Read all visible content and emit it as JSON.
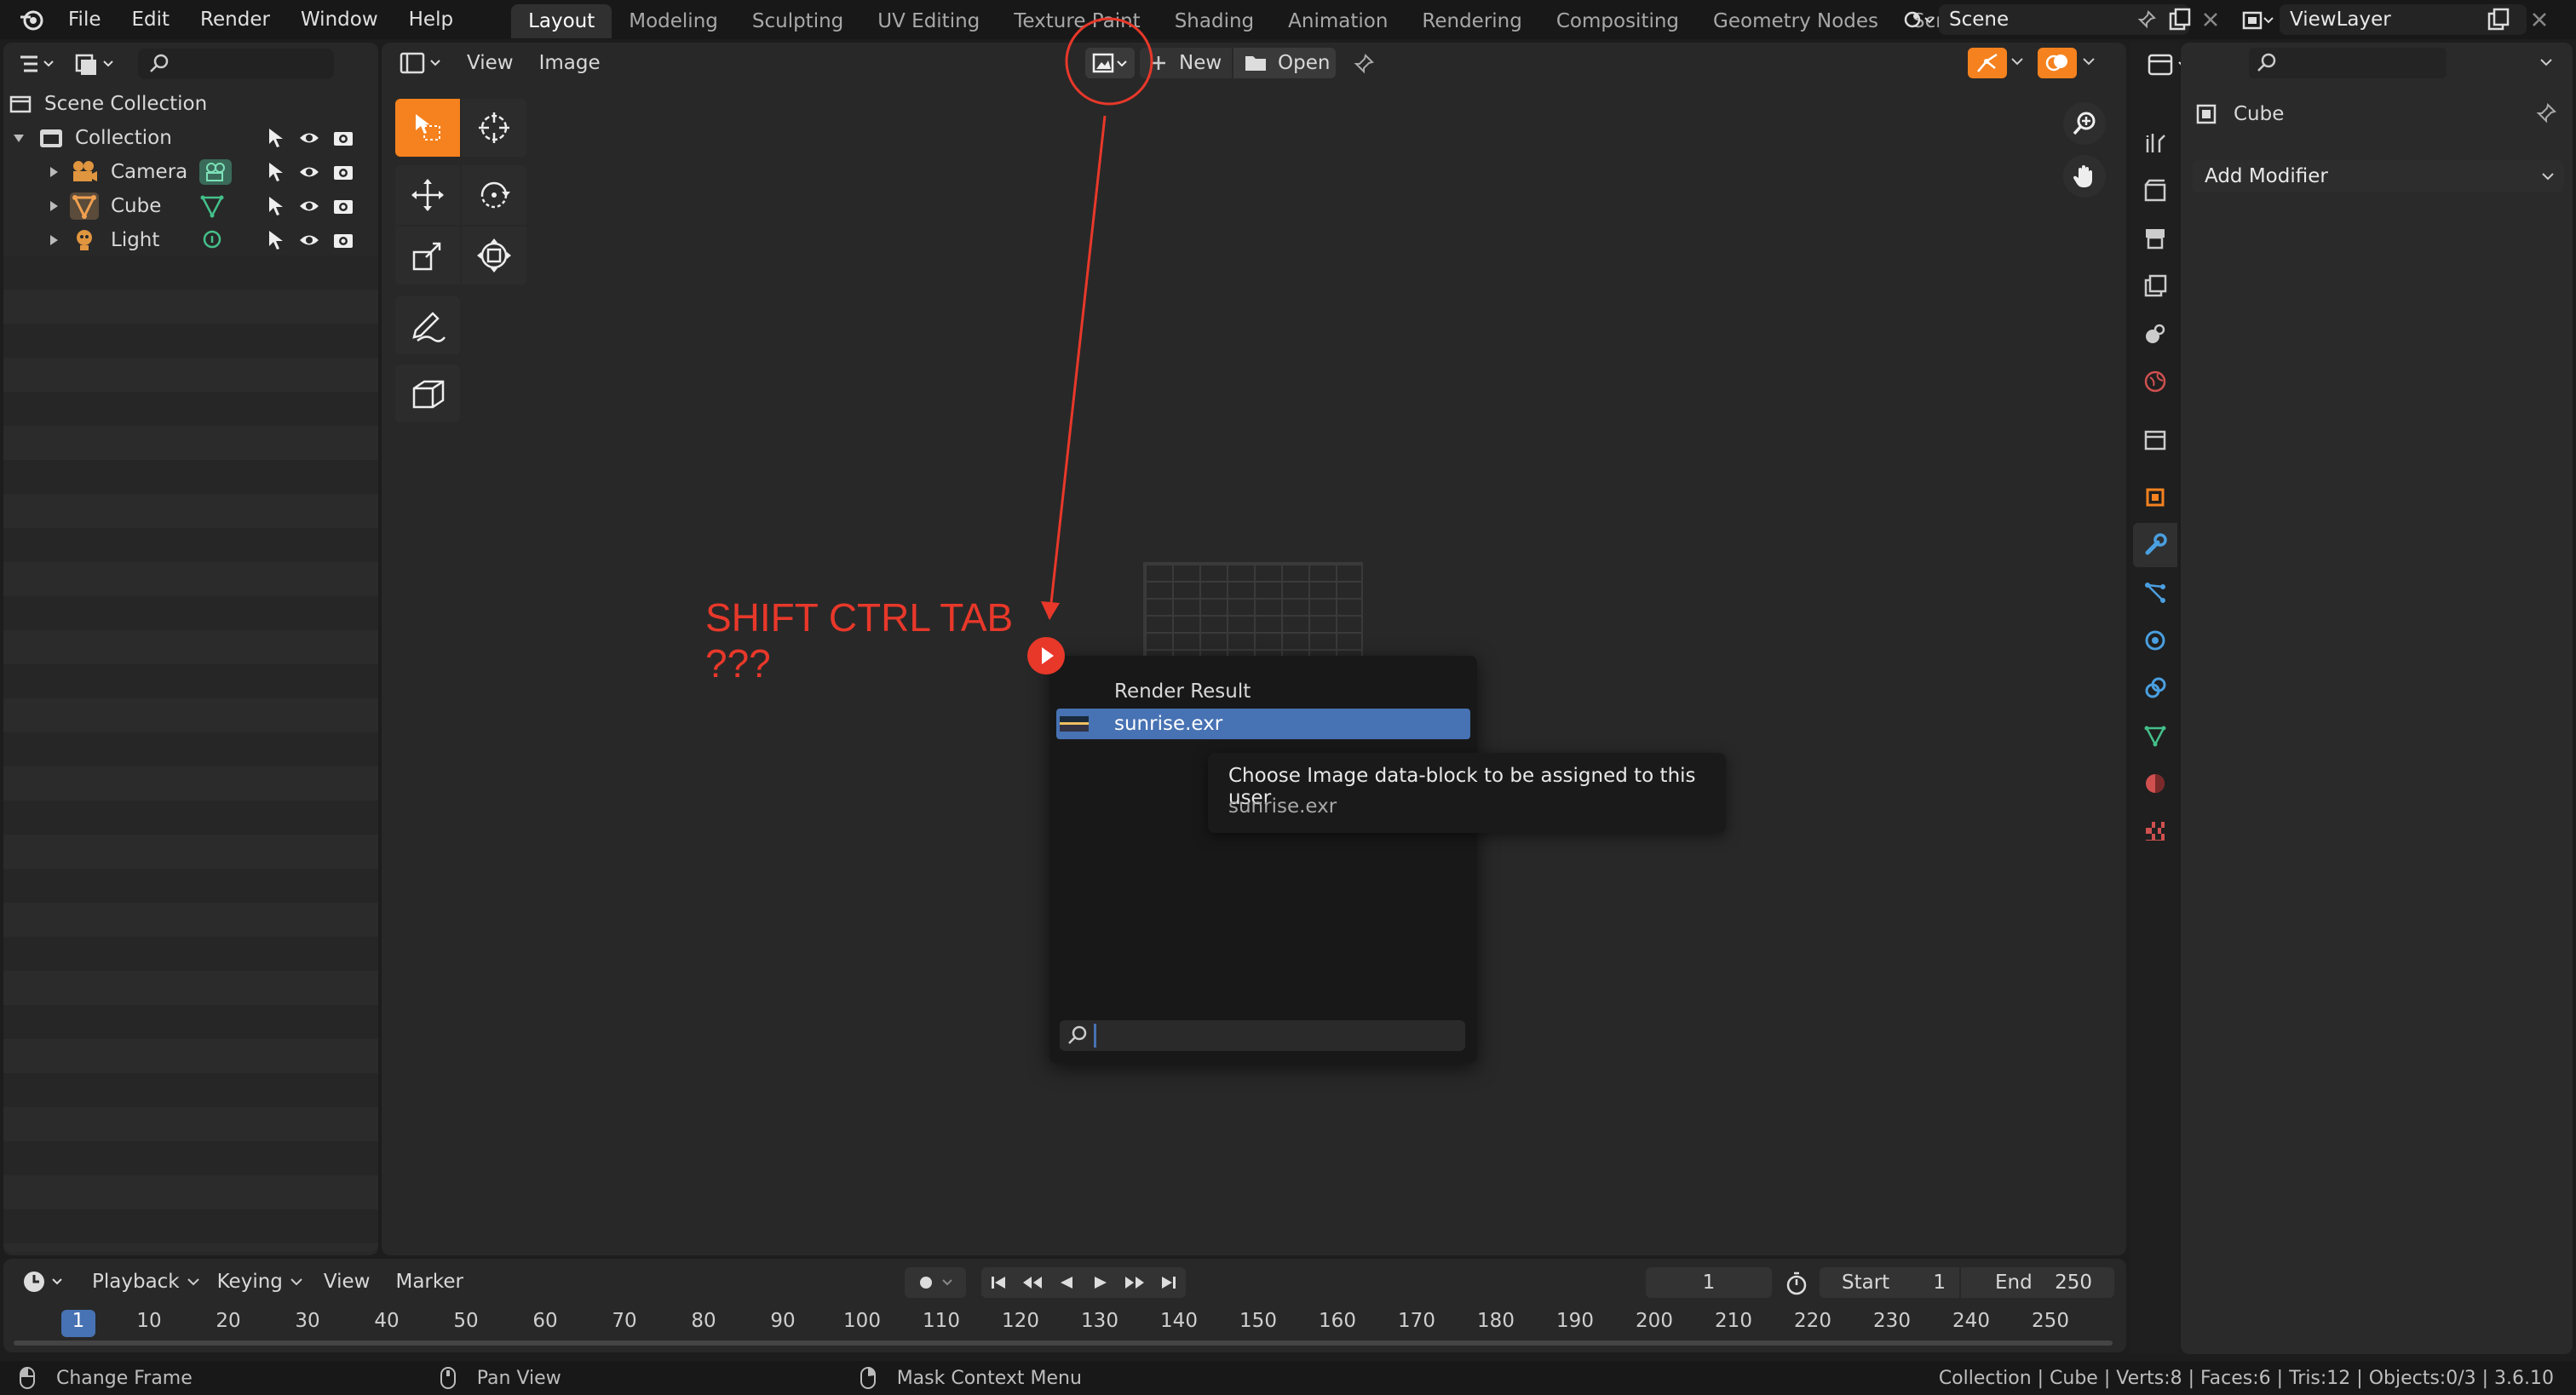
{
  "topbar": {
    "menus": [
      "File",
      "Edit",
      "Render",
      "Window",
      "Help"
    ],
    "workspaces": [
      "Layout",
      "Modeling",
      "Sculpting",
      "UV Editing",
      "Texture Paint",
      "Shading",
      "Animation",
      "Rendering",
      "Compositing",
      "Geometry Nodes",
      "Scripting"
    ],
    "add_tab": "+",
    "scene": "Scene",
    "view_layer": "ViewLayer"
  },
  "outliner": {
    "root": "Scene Collection",
    "items": [
      {
        "label": "Collection"
      },
      {
        "label": "Camera"
      },
      {
        "label": "Cube"
      },
      {
        "label": "Light"
      }
    ]
  },
  "image_editor": {
    "menus": [
      "View",
      "Image"
    ],
    "new_label": "New",
    "open_label": "Open"
  },
  "annotation": {
    "line1": "SHIFT CTRL TAB",
    "line2": "???",
    "color": "#e8382a"
  },
  "popup": {
    "items": [
      "Render Result",
      "sunrise.exr"
    ],
    "search_placeholder": ""
  },
  "tooltip": {
    "title": "Choose Image data-block to be assigned to this user",
    "subtitle": "sunrise.exr"
  },
  "properties": {
    "object_name": "Cube",
    "add_modifier": "Add Modifier"
  },
  "timeline": {
    "menus": [
      "Playback",
      "Keying",
      "View",
      "Marker"
    ],
    "current_frame": "1",
    "start_label": "Start",
    "start_value": "1",
    "end_label": "End",
    "end_value": "250",
    "ruler": [
      "1",
      "10",
      "20",
      "30",
      "40",
      "50",
      "60",
      "70",
      "80",
      "90",
      "100",
      "110",
      "120",
      "130",
      "140",
      "150",
      "160",
      "170",
      "180",
      "190",
      "200",
      "210",
      "220",
      "230",
      "240",
      "250"
    ]
  },
  "statusbar": {
    "left": "Change Frame",
    "middle": "Pan View",
    "right_hint": "Mask Context Menu",
    "stats": "Collection | Cube | Verts:8 | Faces:6 | Tris:12 | Objects:0/3 | 3.6.10"
  },
  "colors": {
    "accent_orange": "#f5821f",
    "selection_blue": "#4772b3",
    "background": "#1d1d1d"
  }
}
